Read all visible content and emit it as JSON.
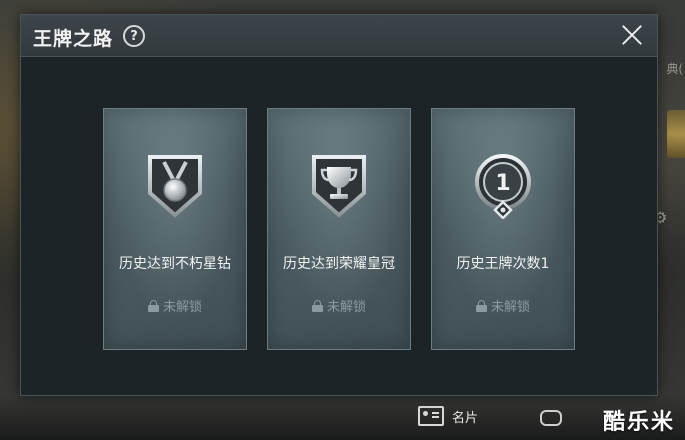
{
  "dialog": {
    "title": "王牌之路",
    "help_icon": "?",
    "close_icon": "close-icon"
  },
  "achievements": [
    {
      "icon": "medal-shield-icon",
      "label": "历史达到不朽星钻",
      "status": "未解锁"
    },
    {
      "icon": "trophy-shield-icon",
      "label": "历史达到荣耀皇冠",
      "status": "未解锁"
    },
    {
      "icon": "ace-count-badge-icon",
      "badge_number": "1",
      "label": "历史王牌次数1",
      "status": "未解锁"
    }
  ],
  "background": {
    "side_text": "典(",
    "bottom_bar_label": "名片"
  },
  "watermark": "酷乐米",
  "colors": {
    "dialog_bg": "#1d2428",
    "card_bg": "#4b5c62",
    "locked_text": "#8b9aa0"
  }
}
